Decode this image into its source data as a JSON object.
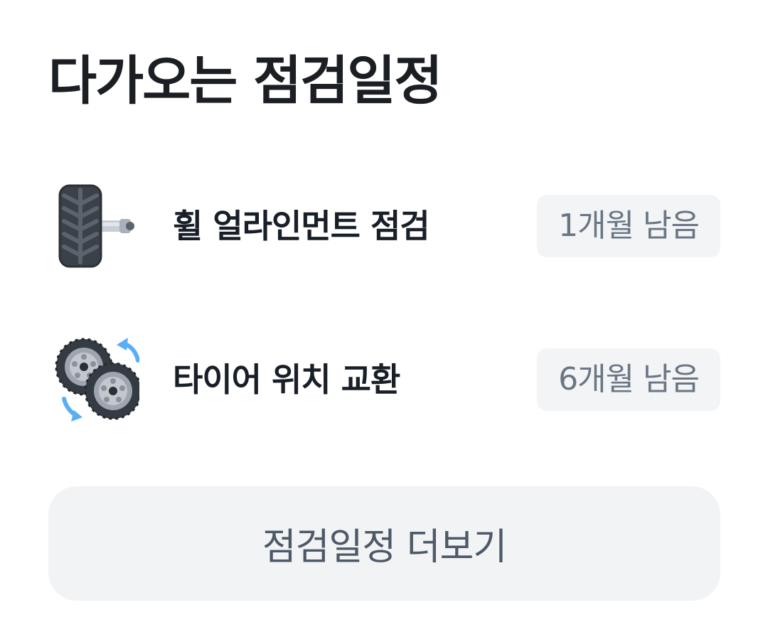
{
  "title": "다가오는 점검일정",
  "schedule": {
    "items": [
      {
        "icon": "wheel-alignment-icon",
        "label": "휠 얼라인먼트 점검",
        "badge": "1개월 남음"
      },
      {
        "icon": "tire-rotation-icon",
        "label": "타이어 위치 교환",
        "badge": "6개월 남음"
      }
    ]
  },
  "more_button": {
    "label": "점검일정 더보기"
  },
  "colors": {
    "badge_bg": "#f2f4f6",
    "badge_text": "#6b7684",
    "button_bg": "#f2f3f5",
    "accent_arrow": "#5aaef5"
  }
}
